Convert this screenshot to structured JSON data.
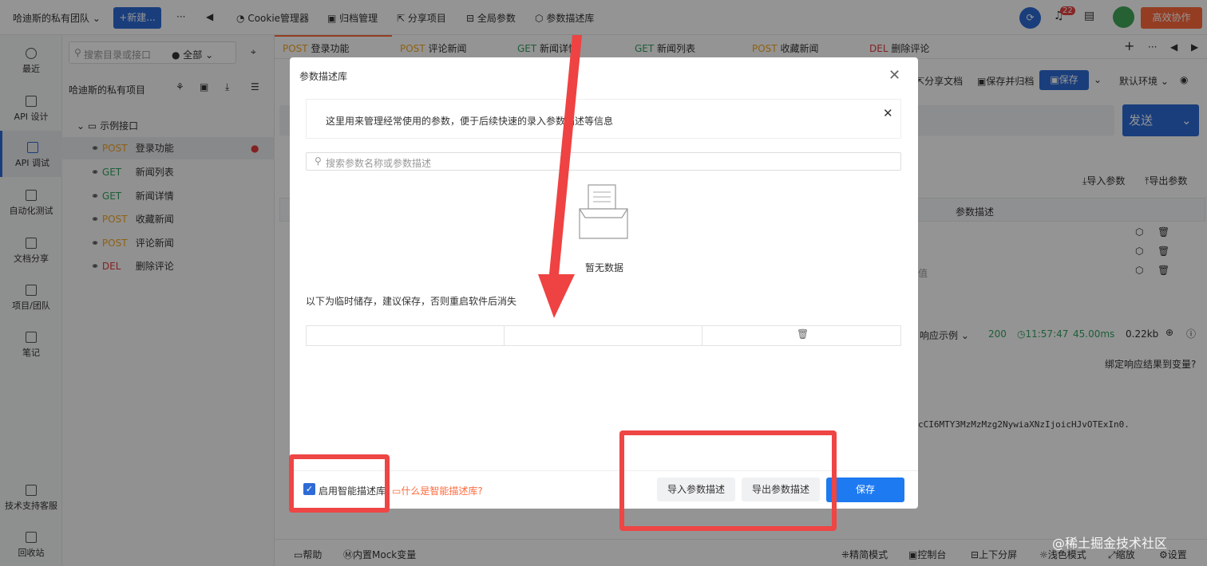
{
  "topbar": {
    "team": "哈迪斯的私有团队",
    "new_btn": "+新建...",
    "more": "···",
    "back": "◀",
    "tools": [
      "Cookie管理器",
      "归档管理",
      "分享项目",
      "全局参数",
      "参数描述库"
    ],
    "notif_count": "22",
    "collab_btn": "高效协作",
    "colors": {
      "accent": "#2e6bd6",
      "collab": "#ff6a3d",
      "badge": "#e84040"
    }
  },
  "sidebar": {
    "items": [
      {
        "label": "最近",
        "icon": "clock-icon"
      },
      {
        "label": "API 设计",
        "icon": "edit-icon"
      },
      {
        "label": "API 调试",
        "icon": "bug-icon"
      },
      {
        "label": "自动化测试",
        "icon": "flow-icon"
      },
      {
        "label": "文档分享",
        "icon": "doc-icon"
      },
      {
        "label": "项目/团队",
        "icon": "folder-icon"
      },
      {
        "label": "笔记",
        "icon": "note-icon"
      }
    ],
    "bottom": [
      {
        "label": "技术支持客服"
      },
      {
        "label": "回收站"
      }
    ]
  },
  "tree": {
    "search_placeholder": "搜索目录或接口",
    "filter": "全部",
    "project": "哈迪斯的私有项目",
    "folder": "示例接口",
    "items": [
      {
        "method": "POST",
        "name": "登录功能"
      },
      {
        "method": "GET",
        "name": "新闻列表"
      },
      {
        "method": "GET",
        "name": "新闻详情"
      },
      {
        "method": "POST",
        "name": "收藏新闻"
      },
      {
        "method": "POST",
        "name": "评论新闻"
      },
      {
        "method": "DEL",
        "name": "删除评论"
      }
    ]
  },
  "tabs": [
    {
      "method": "POST",
      "name": "登录功能"
    },
    {
      "method": "POST",
      "name": "评论新闻"
    },
    {
      "method": "GET",
      "name": "新闻详情"
    },
    {
      "method": "GET",
      "name": "新闻列表"
    },
    {
      "method": "POST",
      "name": "收藏新闻"
    },
    {
      "method": "DEL",
      "name": "删除评论"
    }
  ],
  "toolbar": {
    "share_doc": "分享文档",
    "save_archive": "保存并归档",
    "save": "保存",
    "env": "默认环境",
    "send": "发送",
    "import_params": "导入参数",
    "export_params": "导出参数",
    "param_desc_col": "参数描述",
    "partial_text": "值"
  },
  "response": {
    "example": "响应示例",
    "status": "200",
    "time": "11:57:47",
    "duration": "45.00ms",
    "size": "0.22kb",
    "bind_text": "绑定响应结果到变量?",
    "token_text": "cCI6MTY3MzMzMzg2NywiaXNzIjoicHJvOTExIn0."
  },
  "footer": {
    "items": [
      "帮助",
      "内置Mock变量",
      "精简模式",
      "控制台",
      "上下分屏",
      "浅色模式",
      "缩放",
      "设置"
    ],
    "watermark": "@稀土掘金技术社区"
  },
  "dialog": {
    "title": "参数描述库",
    "info": "这里用来管理经常使用的参数，便于后续快速的录入参数描述等信息",
    "search_placeholder": "搜索参数名称或参数描述",
    "empty": "暂无数据",
    "temp_note": "以下为临时储存，建议保存，否则重启软件后消失",
    "checkbox_label": "启用智能描述库",
    "help_link": "什么是智能描述库?",
    "import_btn": "导入参数描述",
    "export_btn": "导出参数描述",
    "save_btn": "保存"
  }
}
